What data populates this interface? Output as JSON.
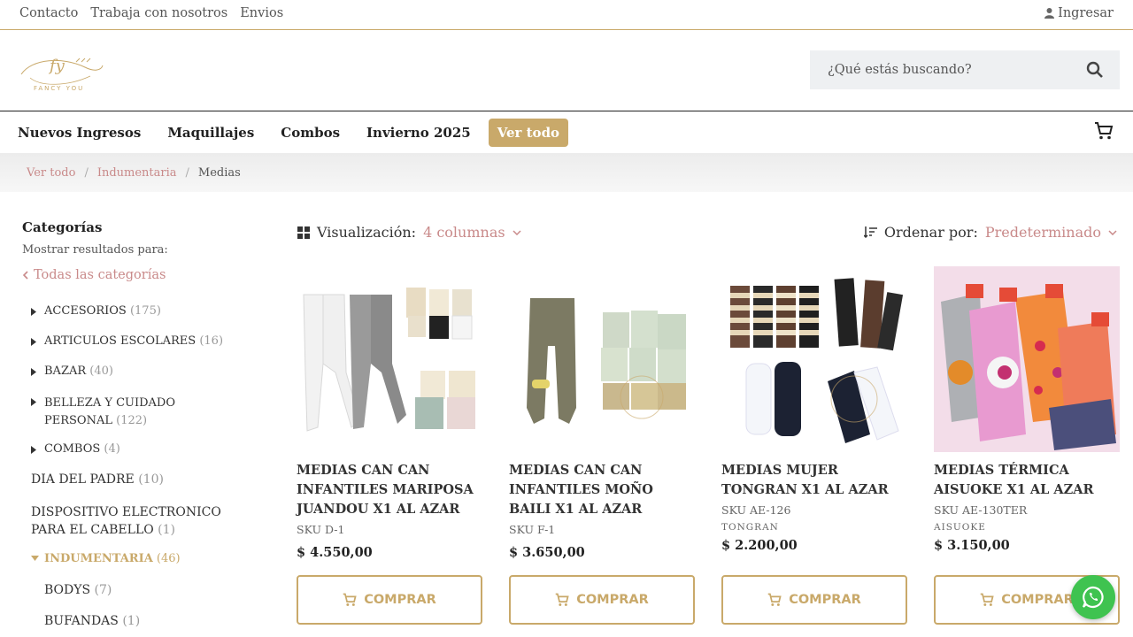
{
  "topbar": {
    "links": [
      "Contacto",
      "Trabaja con nosotros",
      "Envios"
    ],
    "login": "Ingresar"
  },
  "logo": {
    "text": "FANCY YOU"
  },
  "search": {
    "placeholder": "¿Qué estás buscando?"
  },
  "nav": {
    "items": [
      "Nuevos Ingresos",
      "Maquillajes",
      "Combos",
      "Invierno 2025"
    ],
    "view_all": "Ver todo"
  },
  "breadcrumb": [
    "Ver todo",
    "Indumentaria",
    "Medias"
  ],
  "sidebar": {
    "title": "Categorías",
    "subtitle": "Mostrar resultados para:",
    "all_categories": "Todas las categorías",
    "categories": [
      {
        "name": "ACCESORIOS",
        "count": "(175)"
      },
      {
        "name": "ARTICULOS ESCOLARES",
        "count": "(16)"
      },
      {
        "name": "BAZAR",
        "count": "(40)"
      },
      {
        "name": "BELLEZA Y CUIDADO PERSONAL",
        "count": "(122)"
      },
      {
        "name": "COMBOS",
        "count": "(4)"
      },
      {
        "name": "DIA DEL PADRE",
        "count": "(10)"
      },
      {
        "name": "DISPOSITIVO ELECTRONICO PARA EL CABELLO",
        "count": "(1)"
      },
      {
        "name": "INDUMENTARIA",
        "count": "(46)"
      },
      {
        "name": "BODYS",
        "count": "(7)"
      },
      {
        "name": "BUFANDAS",
        "count": "(1)"
      }
    ]
  },
  "toolbar": {
    "view_label": "Visualización:",
    "view_value": "4 columnas",
    "sort_label": "Ordenar por:",
    "sort_value": "Predeterminado"
  },
  "products": [
    {
      "title": "MEDIAS CAN CAN INFANTILES MARIPOSA JUANDOU X1 AL AZAR",
      "sku": "SKU D-1",
      "brand": "",
      "price": "$  4.550,00"
    },
    {
      "title": "MEDIAS CAN CAN INFANTILES MOÑO BAILI X1 AL AZAR",
      "sku": "SKU F-1",
      "brand": "",
      "price": "$  3.650,00"
    },
    {
      "title": "MEDIAS MUJER TONGRAN X1 AL AZAR",
      "sku": "SKU AE-126",
      "brand": "TONGRAN",
      "price": "$  2.200,00"
    },
    {
      "title": "MEDIAS TÉRMICA AISUOKE X1 AL AZAR",
      "sku": "SKU AE-130TER",
      "brand": "AISUOKE",
      "price": "$  3.150,00"
    }
  ],
  "buy_label": "COMPRAR",
  "colors": {
    "accent": "#c9a96a",
    "link": "#c98a8a",
    "whatsapp": "#3fc350"
  }
}
